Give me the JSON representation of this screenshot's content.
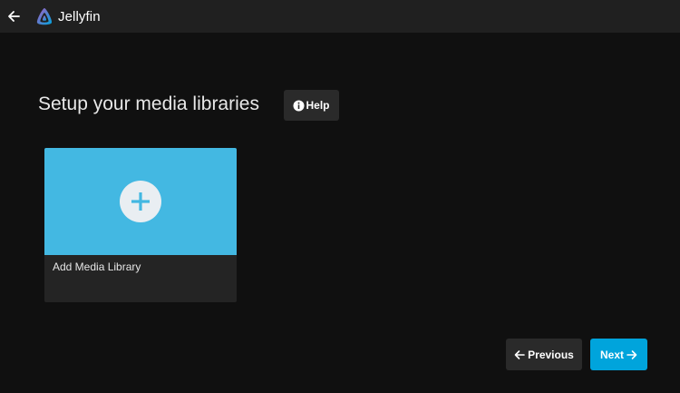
{
  "header": {
    "back_icon": "arrow-left-icon",
    "logo_icon": "jellyfin-logo-icon",
    "app_name": "Jellyfin"
  },
  "main": {
    "title": "Setup your media libraries",
    "help_button": {
      "icon": "info-icon",
      "label": "Help"
    },
    "library_card": {
      "icon": "plus-icon",
      "label": "Add Media Library",
      "accent_color": "#43b8e2"
    }
  },
  "navigation": {
    "previous": {
      "icon": "arrow-left-icon",
      "label": "Previous"
    },
    "next": {
      "icon": "arrow-right-icon",
      "label": "Next",
      "color": "#00a4dc"
    }
  }
}
